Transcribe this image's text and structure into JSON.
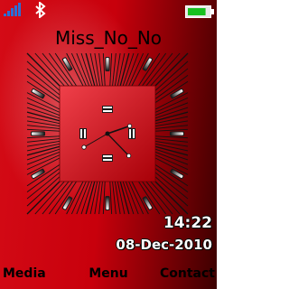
{
  "status": {
    "signal": "signal-strength-icon",
    "bluetooth": "bluetooth-icon",
    "battery": "battery-icon",
    "battery_level": 0.85
  },
  "operator_name": "Miss_No_No",
  "clock": {
    "hour": 14,
    "minute": 22,
    "second": 40
  },
  "time": "14:22",
  "date": "08-Dec-2010",
  "softkeys": {
    "left": "Media",
    "center": "Menu",
    "right": "Contact"
  },
  "colors": {
    "background": "#c8000c",
    "accent_green": "#18c020"
  }
}
